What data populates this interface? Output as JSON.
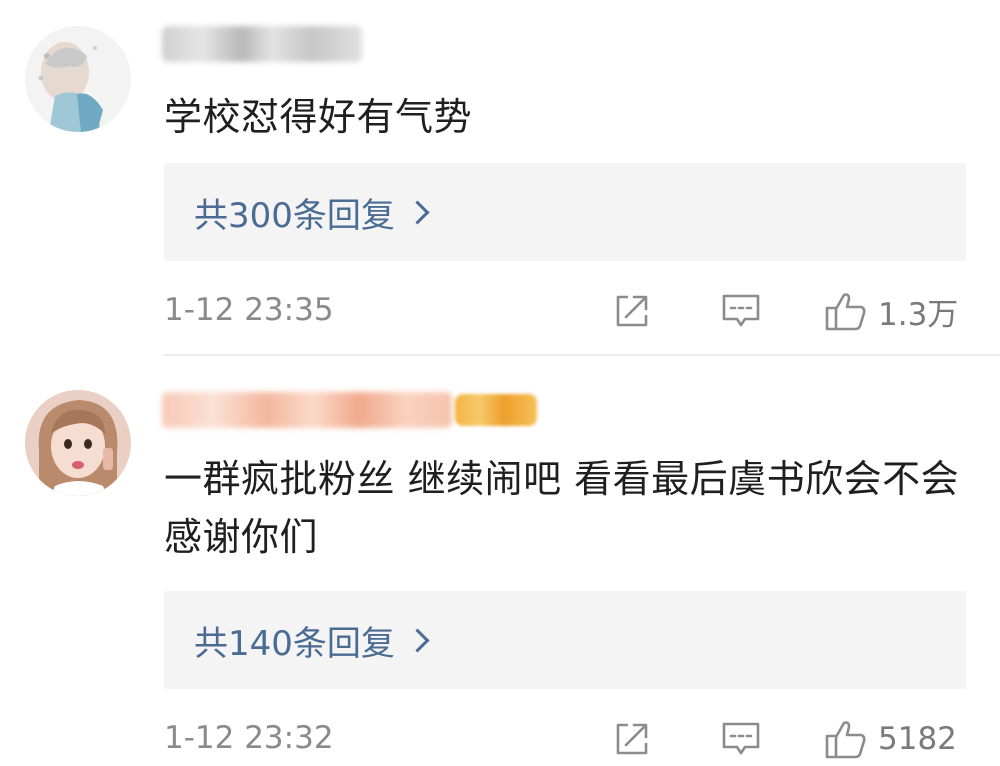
{
  "comments": [
    {
      "text": "学校怼得好有气势",
      "replies_label": "共300条回复",
      "timestamp": "1-12 23:35",
      "likes": "1.3万"
    },
    {
      "text": "一群疯批粉丝 继续闹吧 看看最后虞书欣会不会感谢你们",
      "replies_label": "共140条回复",
      "timestamp": "1-12 23:32",
      "likes": "5182"
    }
  ],
  "icons": {
    "share": "share-icon",
    "comment": "comment-icon",
    "like": "thumbs-up-icon",
    "reply_arrow": "chevron-right-icon"
  },
  "colors": {
    "reply_link": "#4a6c93",
    "reply_box_bg": "#f4f4f4",
    "meta_text": "#8a8a8a",
    "badge": "#f2b443"
  }
}
